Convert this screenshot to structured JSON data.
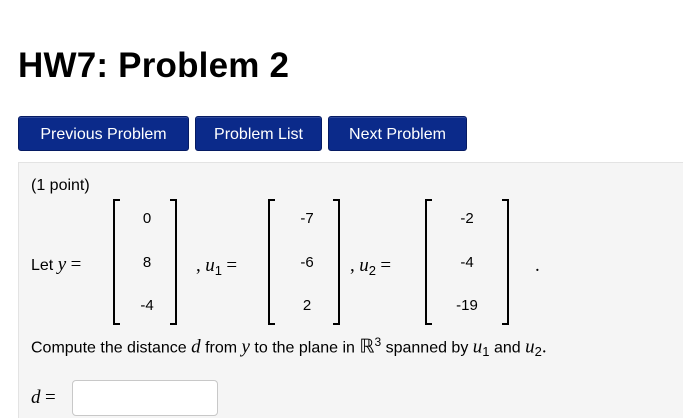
{
  "header": {
    "title": "HW7: Problem 2"
  },
  "nav": {
    "previous_label": "Previous Problem",
    "list_label": "Problem List",
    "next_label": "Next Problem"
  },
  "problem": {
    "points": "(1 point)",
    "let_text": "Let",
    "y_symbol": "y",
    "u_symbol": "u",
    "u1_index": "1",
    "u2_index": "2",
    "equals": "=",
    "comma": ",",
    "period": ".",
    "y_vector": [
      "0",
      "8",
      "-4"
    ],
    "u1_vector": [
      "-7",
      "-6",
      "2"
    ],
    "u2_vector": [
      "-2",
      "-4",
      "-19"
    ],
    "question": {
      "part1": "Compute the distance",
      "d_symbol": "d",
      "part2": "from",
      "part3": "to the plane in",
      "R_symbol": "ℝ",
      "R_exponent": "3",
      "part4": "spanned by",
      "part5": "and",
      "period": "."
    },
    "answer": {
      "label": "d",
      "equals": "=",
      "value": ""
    }
  }
}
